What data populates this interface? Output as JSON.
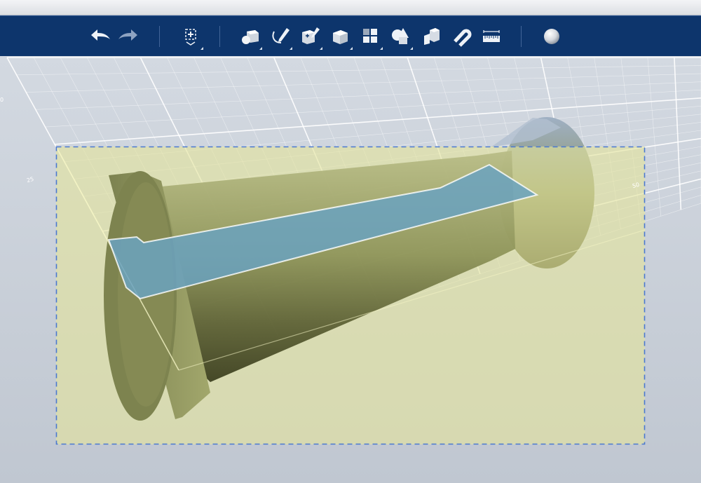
{
  "toolbar": {
    "buttons": [
      {
        "id": "undo",
        "icon": "undo-arrow-icon",
        "has_menu": false
      },
      {
        "id": "redo",
        "icon": "redo-arrow-icon",
        "has_menu": false
      },
      {
        "id": "add",
        "icon": "add-box-icon",
        "has_menu": true
      },
      {
        "id": "primitives",
        "icon": "primitives-icon",
        "has_menu": true
      },
      {
        "id": "sketch",
        "icon": "sketch-pen-icon",
        "has_menu": true
      },
      {
        "id": "construct",
        "icon": "construct-icon",
        "has_menu": true
      },
      {
        "id": "modify",
        "icon": "modify-cube-icon",
        "has_menu": true
      },
      {
        "id": "pattern",
        "icon": "pattern-grid-icon",
        "has_menu": true
      },
      {
        "id": "grouping",
        "icon": "combine-shapes-icon",
        "has_menu": true
      },
      {
        "id": "boolean",
        "icon": "boolean-blocks-icon",
        "has_menu": false
      },
      {
        "id": "snap",
        "icon": "snap-magnet-icon",
        "has_menu": false
      },
      {
        "id": "measure",
        "icon": "measure-ruler-icon",
        "has_menu": false
      },
      {
        "id": "material",
        "icon": "material-sphere-icon",
        "has_menu": false
      }
    ]
  },
  "viewport": {
    "grid_labels": [
      "0",
      "25",
      "50"
    ],
    "colors": {
      "background": "#c6cdd7",
      "grid": "#ffffff",
      "body": "#9aa25f",
      "section_plane": "#e3e39c",
      "section_face": "#6aa2c0",
      "selection": "#4a78d0"
    }
  }
}
